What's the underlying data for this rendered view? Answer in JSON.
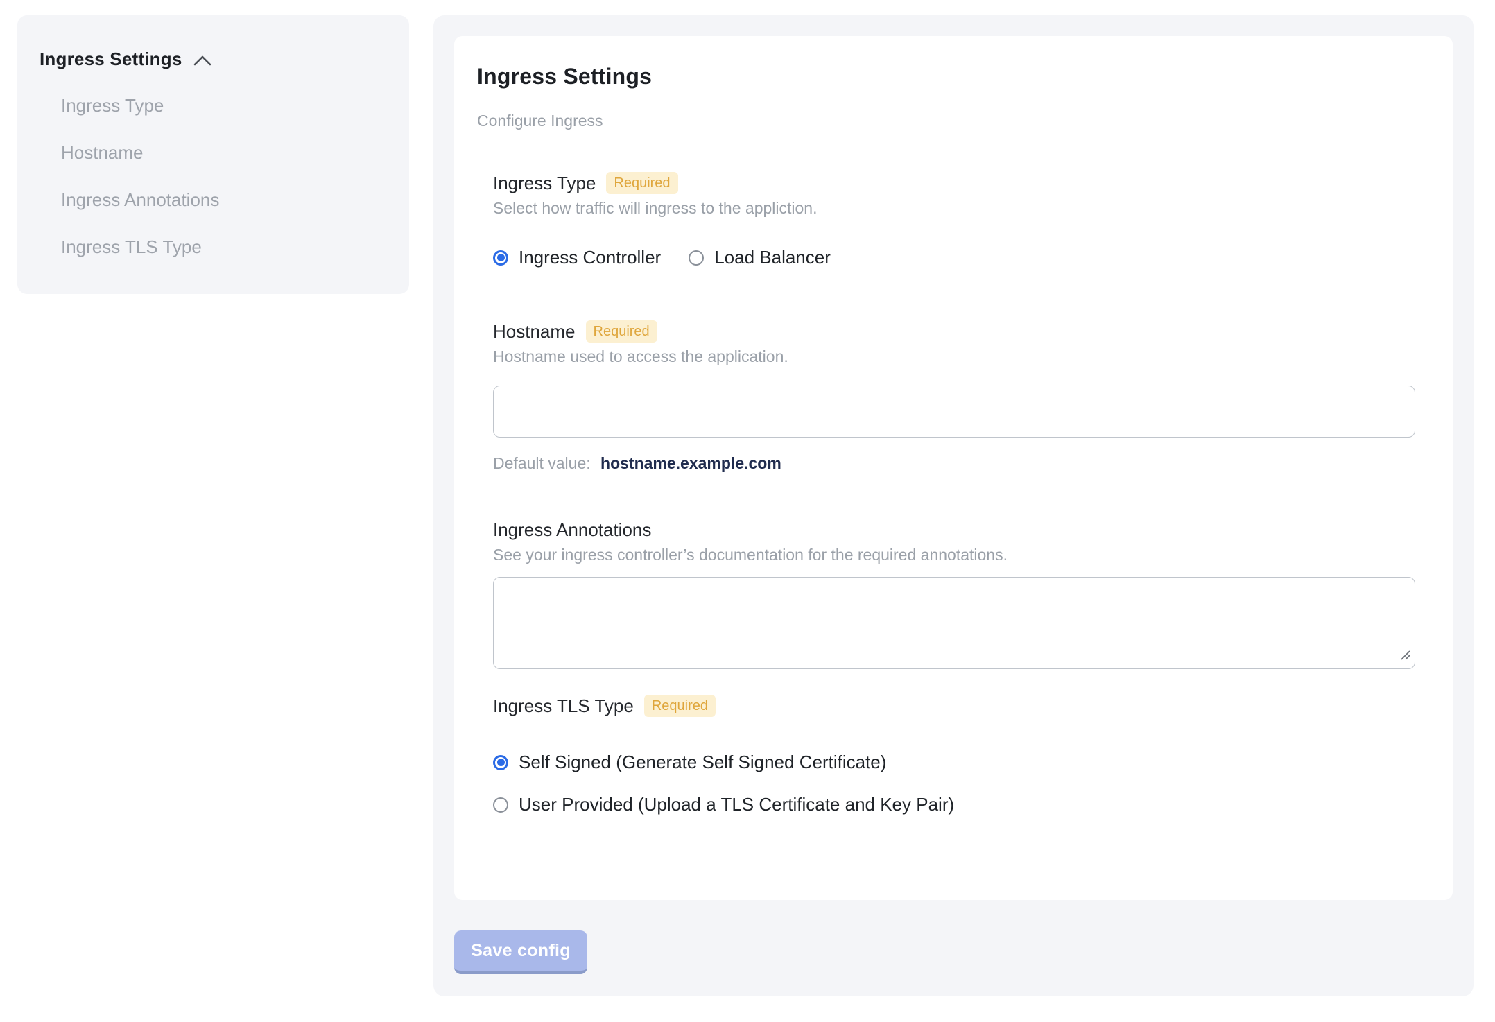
{
  "sidebar": {
    "title": "Ingress Settings",
    "collapse_icon": "chevron-up-icon",
    "items": [
      {
        "label": "Ingress Type"
      },
      {
        "label": "Hostname"
      },
      {
        "label": "Ingress Annotations"
      },
      {
        "label": "Ingress TLS Type"
      }
    ]
  },
  "main": {
    "title": "Ingress Settings",
    "subtitle": "Configure Ingress",
    "sections": {
      "ingress_type": {
        "label": "Ingress Type",
        "badge": "Required",
        "description": "Select how traffic will ingress to the appliction.",
        "options": [
          {
            "label": "Ingress Controller",
            "selected": true
          },
          {
            "label": "Load Balancer",
            "selected": false
          }
        ]
      },
      "hostname": {
        "label": "Hostname",
        "badge": "Required",
        "description": "Hostname used to access the application.",
        "input_value": "",
        "default_value_label": "Default value:",
        "default_value": "hostname.example.com"
      },
      "ingress_annotations": {
        "label": "Ingress Annotations",
        "description": "See your ingress controller’s documentation for the required annotations.",
        "textarea_value": ""
      },
      "ingress_tls_type": {
        "label": "Ingress TLS Type",
        "badge": "Required",
        "options": [
          {
            "label": "Self Signed (Generate Self Signed Certificate)",
            "selected": true
          },
          {
            "label": "User Provided (Upload a TLS Certificate and Key Pair)",
            "selected": false
          }
        ]
      }
    },
    "save_button_label": "Save config"
  },
  "colors": {
    "panel_bg": "#f4f5f8",
    "card_bg": "#ffffff",
    "heading_text": "#1d2025",
    "muted_text": "#9aa0a8",
    "badge_bg": "#fcf0d1",
    "badge_text": "#dfa63c",
    "radio_accent": "#2b6be6",
    "default_value_text": "#202c4e",
    "save_button_bg": "#a9b8ea",
    "save_button_edge": "#8a9bc9"
  }
}
